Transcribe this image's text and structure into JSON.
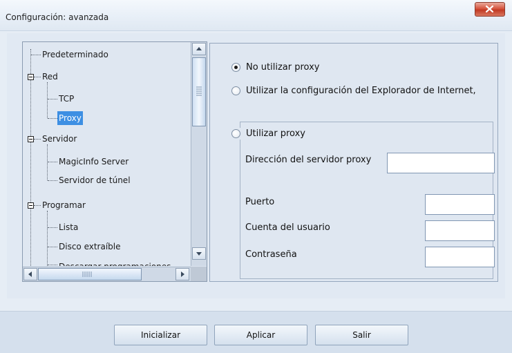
{
  "window": {
    "title": "Configuración: avanzada",
    "close_icon": "close-icon"
  },
  "tree": {
    "items": [
      {
        "label": "Predeterminado"
      },
      {
        "label": "Red"
      },
      {
        "label": "TCP"
      },
      {
        "label": "Proxy",
        "selected": true
      },
      {
        "label": "Servidor"
      },
      {
        "label": "MagicInfo Server"
      },
      {
        "label": "Servidor de túnel"
      },
      {
        "label": "Programar"
      },
      {
        "label": "Lista"
      },
      {
        "label": "Disco extraíble"
      },
      {
        "label": "Descargar programaciones"
      }
    ],
    "scroll_icons": [
      "scroll-up-icon",
      "scroll-down-icon",
      "scroll-left-icon",
      "scroll-right-icon"
    ]
  },
  "proxy": {
    "options": [
      {
        "label": "No utilizar proxy",
        "checked": true
      },
      {
        "label": "Utilizar la configuración del Explorador de Internet,",
        "checked": false
      },
      {
        "label": "Utilizar proxy",
        "checked": false
      }
    ],
    "fields": {
      "server_address_label": "Dirección del servidor proxy",
      "server_address_value": "",
      "port_label": "Puerto",
      "port_value": "",
      "account_label": "Cuenta del usuario",
      "account_value": "",
      "password_label": "Contraseña",
      "password_value": ""
    }
  },
  "footer": {
    "buttons": {
      "initialize": "Inicializar",
      "apply": "Aplicar",
      "exit": "Salir"
    }
  },
  "colors": {
    "selection": "#3d8fe3",
    "close_button": "#c13b24",
    "background": "#e6edf5"
  }
}
